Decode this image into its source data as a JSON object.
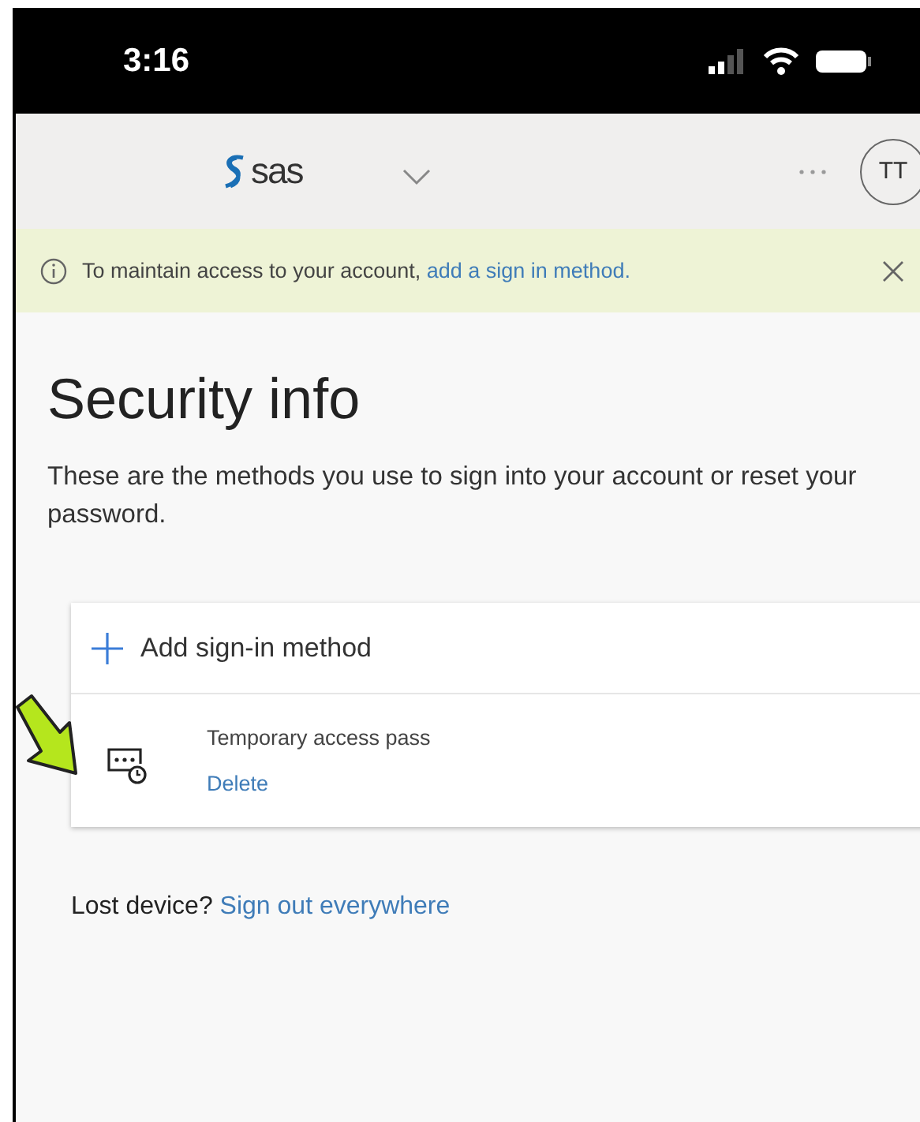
{
  "status_bar": {
    "time": "3:16"
  },
  "header": {
    "logo": "sas",
    "avatar": "TT"
  },
  "banner": {
    "text": "To maintain access to your account, ",
    "link": "add a sign in method."
  },
  "page": {
    "title": "Security info",
    "description": "These are the methods you use to sign into your account or reset your password."
  },
  "add_method": {
    "label": "Add sign-in method"
  },
  "methods": [
    {
      "name": "Temporary access pass",
      "action": "Delete"
    }
  ],
  "footer": {
    "text": "Lost device?",
    "link": "Sign out everywhere"
  }
}
